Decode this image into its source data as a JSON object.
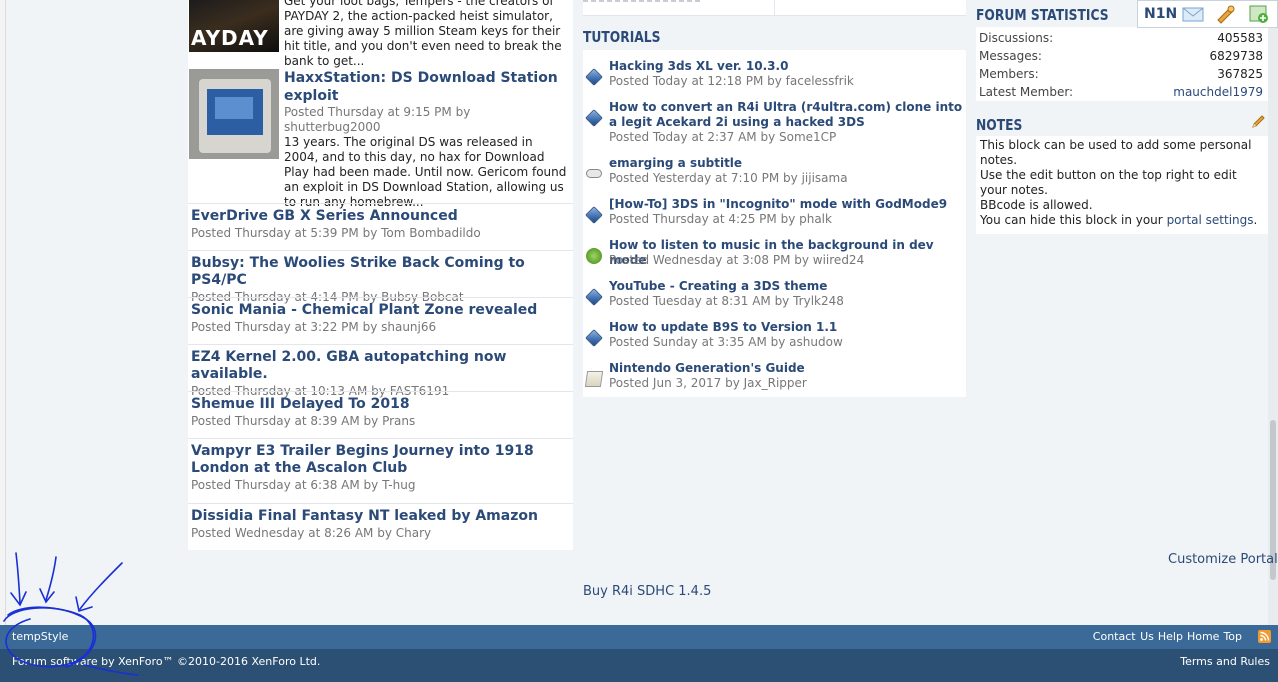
{
  "news": {
    "image_items": [
      {
        "thumb_label": "AYDAY",
        "text": "Get your loot bags, Tempers - the creators of PAYDAY 2, the action-packed heist simulator, are giving away 5 million Steam keys for their hit title, and you don't even need to break the bank to get..."
      },
      {
        "title": "HaxxStation: DS Download Station exploit",
        "meta_prefix": "Posted Thursday at 9:15 PM by",
        "author": "shutterbug2000",
        "text": "13 years. The original DS was released in 2004, and to this day, no hax for Download Play had been made. Until now. Gericom found an exploit in DS Download Station, allowing us to run any homebrew..."
      }
    ],
    "rows": [
      {
        "title": "EverDrive GB X Series Announced",
        "meta": "Posted Thursday at 5:39 PM by Tom Bombadildo"
      },
      {
        "title": "Bubsy: The Woolies Strike Back Coming to PS4/PC",
        "meta": "Posted Thursday at 4:14 PM by Bubsy Bobcat"
      },
      {
        "title": "Sonic Mania - Chemical Plant Zone revealed",
        "meta": "Posted Thursday at 3:22 PM by shaunj66"
      },
      {
        "title": "EZ4 Kernel 2.00. GBA autopatching now available.",
        "meta": "Posted Thursday at 10:13 AM by FAST6191"
      },
      {
        "title": "Shemue III Delayed To 2018",
        "meta": "Posted Thursday at 8:39 AM by Prans"
      },
      {
        "title": "Vampyr E3 Trailer Begins Journey into 1918 London at the Ascalon Club",
        "meta": "Posted Thursday at 6:38 AM by T-hug"
      },
      {
        "title": "Dissidia Final Fantasy NT leaked by Amazon",
        "meta": "Posted Wednesday at 8:26 AM by Chary"
      }
    ]
  },
  "tutorials": {
    "heading": "TUTORIALS",
    "items": [
      {
        "icon": "3ds-cube-icon",
        "title": "Hacking 3ds XL ver. 10.3.0",
        "meta": "Posted Today at 12:18 PM by facelessfrik"
      },
      {
        "icon": "3ds-cube-icon",
        "title": "How to convert an R4i Ultra (r4ultra.com) clone into a legit Acekard 2i using a hacked 3DS",
        "meta": "Posted Today at 2:37 AM by Some1CP"
      },
      {
        "icon": "gamepad-icon",
        "title": "emarging a subtitle",
        "meta": "Posted Yesterday at 7:10 PM by jijisama"
      },
      {
        "icon": "3ds-cube-icon",
        "title": "[How-To] 3DS in \"Incognito\" mode with GodMode9",
        "meta": "Posted Thursday at 4:25 PM by phalk"
      },
      {
        "icon": "xbox-icon",
        "title": "How to listen to music in the background in dev mode",
        "meta": "Posted Wednesday at 3:08 PM by wiired24"
      },
      {
        "icon": "3ds-cube-icon",
        "title": "YouTube - Creating a 3DS theme",
        "meta": "Posted Tuesday at 8:31 AM by Trylk248"
      },
      {
        "icon": "3ds-cube-icon",
        "title": "How to update B9S to Version 1.1",
        "meta": "Posted Sunday at 3:35 AM by ashudow"
      },
      {
        "icon": "document-icon",
        "title": "Nintendo Generation's Guide",
        "meta": "Posted Jun 3, 2017 by Jax_Ripper"
      }
    ]
  },
  "forum_stats": {
    "heading": "FORUM STATISTICS",
    "discussions_label": "Discussions:",
    "discussions": "405583",
    "messages_label": "Messages:",
    "messages": "6829738",
    "members_label": "Members:",
    "members": "367825",
    "latest_label": "Latest Member:",
    "latest": "mauchdel1979"
  },
  "notes": {
    "heading": "NOTES",
    "line1": "This block can be used to add some personal notes.",
    "line2": "Use the edit button on the top right to edit your notes.",
    "line3": "BBcode is allowed.",
    "line4_prefix": "You can hide this block in your",
    "line4_link": "portal settings",
    "line4_suffix": "."
  },
  "topbar": {
    "username": "N1N"
  },
  "links": {
    "customize": "Customize Portal",
    "buy": "Buy R4i SDHC 1.4.5"
  },
  "footer": {
    "style": "tempStyle",
    "contact": "Contact Us",
    "help": "Help",
    "home": "Home",
    "top": "Top",
    "copyright": "Forum software by XenForo™ ©2010-2016 XenForo Ltd.",
    "terms": "Terms and Rules"
  },
  "colors": {
    "link": "#2b4a78",
    "footer_top": "#3b6a98",
    "footer_bottom": "#2c4f74",
    "annotation": "#1a2fd6"
  }
}
